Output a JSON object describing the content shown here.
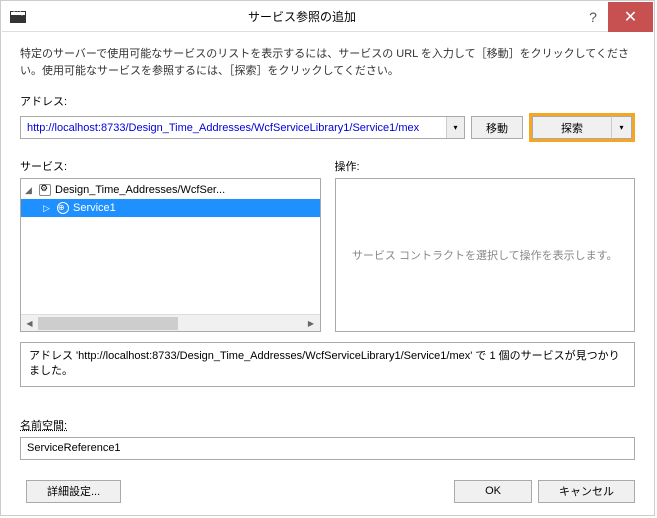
{
  "dialog": {
    "title": "サービス参照の追加",
    "description": "特定のサーバーで使用可能なサービスのリストを表示するには、サービスの URL を入力して［移動］をクリックしてください。使用可能なサービスを参照するには、［探索］をクリックしてください。"
  },
  "address": {
    "label": "アドレス:",
    "value": "http://localhost:8733/Design_Time_Addresses/WcfServiceLibrary1/Service1/mex",
    "go_label": "移動",
    "discover_label": "探索"
  },
  "services": {
    "label": "サービス:",
    "tree": [
      {
        "label": "Design_Time_Addresses/WcfSer...",
        "expanded": true,
        "level": 0,
        "icon": "gear"
      },
      {
        "label": "Service1",
        "expanded": false,
        "level": 1,
        "icon": "globe",
        "selected": true
      }
    ]
  },
  "operations": {
    "label": "操作:",
    "placeholder": "サービス コントラクトを選択して操作を表示します。"
  },
  "status": {
    "text": "アドレス 'http://localhost:8733/Design_Time_Addresses/WcfServiceLibrary1/Service1/mex' で 1 個のサービスが見つかりました。"
  },
  "namespace": {
    "label": "名前空間:",
    "value": "ServiceReference1"
  },
  "buttons": {
    "advanced": "詳細設定...",
    "ok": "OK",
    "cancel": "キャンセル"
  }
}
